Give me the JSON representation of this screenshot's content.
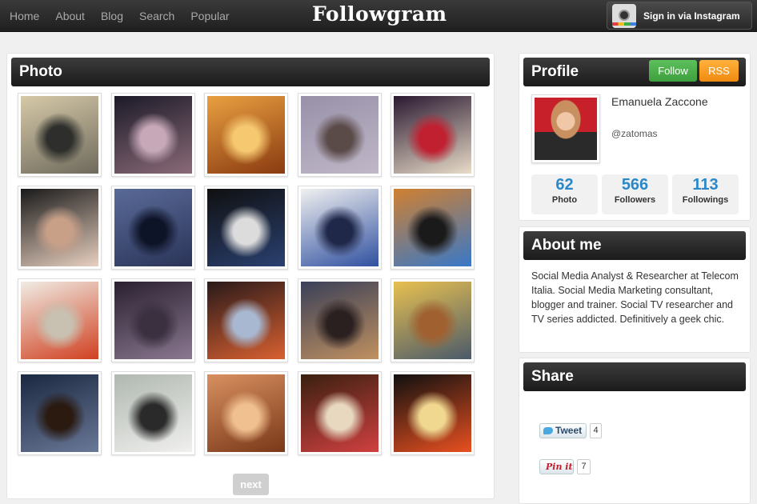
{
  "nav": {
    "items": [
      "Home",
      "About",
      "Blog",
      "Search",
      "Popular"
    ]
  },
  "logo": {
    "text": "Followgram"
  },
  "signin": {
    "label": "Sign in via Instagram"
  },
  "photo_panel": {
    "title": "Photo",
    "next_label": "next"
  },
  "photos": [
    {
      "name": "river-bridge",
      "colors": [
        "#d6c9a8",
        "#6e6a5c",
        "#2e2f2c"
      ]
    },
    {
      "name": "lattice-pie",
      "colors": [
        "#1c1a28",
        "#8a6a78",
        "#c6a8b8"
      ]
    },
    {
      "name": "dachshund-ball",
      "colors": [
        "#e8a040",
        "#8a3a10",
        "#f6c870"
      ]
    },
    {
      "name": "tiny-dog-floor",
      "colors": [
        "#9890a8",
        "#c0b8c8",
        "#5a4a48"
      ]
    },
    {
      "name": "chocolate-bunny",
      "colors": [
        "#2a1830",
        "#e8dcc8",
        "#c02030"
      ]
    },
    {
      "name": "sprinkle-cake",
      "colors": [
        "#1a1a1a",
        "#e8d0c0",
        "#c8a088"
      ]
    },
    {
      "name": "evening-sky",
      "colors": [
        "#5a6a98",
        "#2a3458",
        "#0e1428"
      ]
    },
    {
      "name": "sfi-bulletin",
      "colors": [
        "#101010",
        "#2a4070",
        "#dcdcdc"
      ]
    },
    {
      "name": "converse-shoes",
      "colors": [
        "#f0f0f0",
        "#3050a0",
        "#20284a"
      ]
    },
    {
      "name": "duck-slippers",
      "colors": [
        "#d08030",
        "#3878c8",
        "#1a1a1a"
      ]
    },
    {
      "name": "game-theory-book",
      "colors": [
        "#f0ece4",
        "#d04020",
        "#c8c0b0"
      ]
    },
    {
      "name": "blossom-branches",
      "colors": [
        "#2a2030",
        "#8a7890",
        "#3a3040"
      ]
    },
    {
      "name": "business-card",
      "colors": [
        "#2a1a1a",
        "#d86030",
        "#a8b8d0"
      ]
    },
    {
      "name": "milan-cathedral",
      "colors": [
        "#3a4058",
        "#c09060",
        "#2a2020"
      ]
    },
    {
      "name": "office-room",
      "colors": [
        "#e8c050",
        "#4a5a6a",
        "#a06030"
      ]
    },
    {
      "name": "dusk-buildings",
      "colors": [
        "#1a2840",
        "#6a7898",
        "#2a1a10"
      ]
    },
    {
      "name": "misty-city",
      "colors": [
        "#b0b8b0",
        "#f0f0ee",
        "#2a2a2a"
      ]
    },
    {
      "name": "dachshund-tiles",
      "colors": [
        "#d89060",
        "#7a3818",
        "#f0c090"
      ]
    },
    {
      "name": "dog-sleeping",
      "colors": [
        "#3a2010",
        "#d04040",
        "#e8d8c0"
      ]
    },
    {
      "name": "orange-mug",
      "colors": [
        "#101010",
        "#e85020",
        "#f0d890"
      ]
    }
  ],
  "profile": {
    "title": "Profile",
    "follow_label": "Follow",
    "rss_label": "RSS",
    "name": "Emanuela Zaccone",
    "username": "@zatomas",
    "stats": [
      {
        "value": "62",
        "label": "Photo"
      },
      {
        "value": "566",
        "label": "Followers"
      },
      {
        "value": "113",
        "label": "Followings"
      }
    ]
  },
  "about": {
    "title": "About me",
    "text": "Social Media Analyst & Researcher at Telecom Italia. Social Media Marketing consultant, blogger and trainer. Social TV researcher and TV series addicted. Definitively a geek chic."
  },
  "share": {
    "title": "Share",
    "tweet_label": "Tweet",
    "tweet_count": "4",
    "pin_label": "Pin it",
    "pin_count": "7"
  },
  "colors": {
    "header_dark": "#1f1f1f",
    "follow_green": "#4cae4c",
    "rss_orange": "#f7a21c",
    "stat_blue": "#2a88c8"
  }
}
